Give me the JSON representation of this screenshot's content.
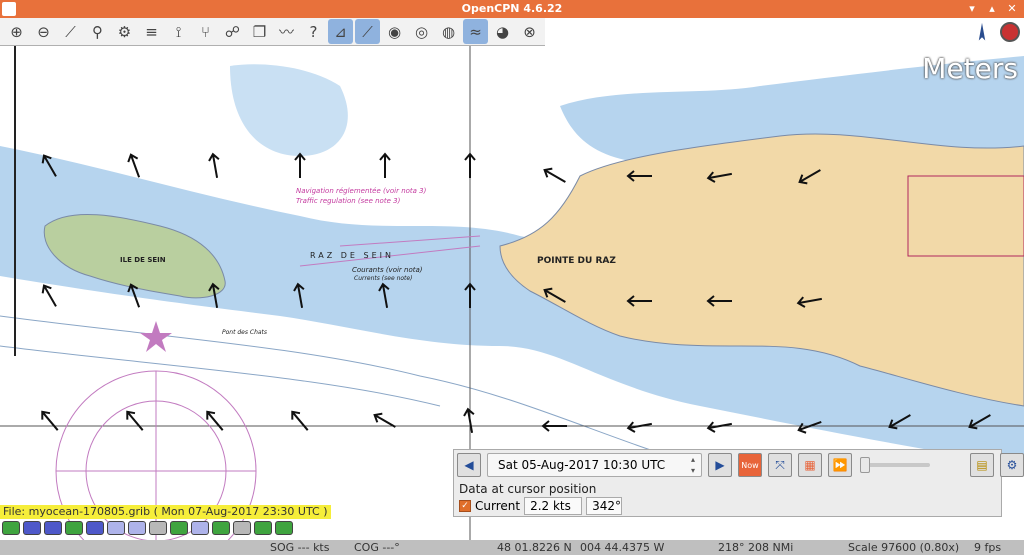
{
  "window": {
    "title": "OpenCPN 4.6.22",
    "units_label": "Meters"
  },
  "toolbar": {
    "tools": [
      {
        "name": "zoom-in-icon",
        "glyph": "⊕"
      },
      {
        "name": "zoom-out-icon",
        "glyph": "⊖"
      },
      {
        "name": "scale-icon",
        "glyph": "⟋"
      },
      {
        "name": "waypoint-icon",
        "glyph": "⚲"
      },
      {
        "name": "settings-icon",
        "glyph": "⚙"
      },
      {
        "name": "text-icon",
        "glyph": "≡"
      },
      {
        "name": "route-icon",
        "glyph": "⟟"
      },
      {
        "name": "track-icon",
        "glyph": "⑂"
      },
      {
        "name": "mob-icon",
        "glyph": "☍"
      },
      {
        "name": "copy-icon",
        "glyph": "❐"
      },
      {
        "name": "tide-icon",
        "glyph": "〰"
      },
      {
        "name": "help-icon",
        "glyph": "?"
      },
      {
        "name": "grib-icon",
        "glyph": "⊿"
      },
      {
        "name": "measure-icon",
        "glyph": "⟋"
      },
      {
        "name": "record-icon",
        "glyph": "◉"
      },
      {
        "name": "playback-icon",
        "glyph": "◎"
      },
      {
        "name": "radar-icon",
        "glyph": "◍"
      },
      {
        "name": "weather-icon",
        "glyph": "≈"
      },
      {
        "name": "globe-icon",
        "glyph": "◕"
      },
      {
        "name": "lifebuoy-icon",
        "glyph": "⊗"
      }
    ]
  },
  "grib": {
    "date": "Sat 05-Aug-2017 10:30  UTC",
    "data_title": "Data at cursor position",
    "current_label": "Current",
    "current_speed": "2.2 kts",
    "current_dir": "342°",
    "file_label": "File: myocean-170805.grib ( Mon 07-Aug-2017 23:30  UTC )",
    "now_label": "Now"
  },
  "chart_labels": {
    "pointe_du_raz": "POINTE DU RAZ",
    "ile_de_sein": "ILE DE SEIN",
    "raz_de_sein": "RAZ DE SEIN",
    "courants": "Courants (voir nota)",
    "currents": "Currents (see note)",
    "navigation": "Navigation réglementée (voir nota 3)",
    "traffic": "Traffic regulation  (see note 3)",
    "pont_des_chats": "Pont des Chats"
  },
  "status": {
    "sog": "SOG --- kts",
    "cog": "COG ---°",
    "lat": "48 01.8226 N",
    "lon": "004 44.4375 W",
    "bearing_dist": "218°  208 NMi",
    "scale": "Scale 97600 (0.80x)",
    "fps": "9 fps"
  },
  "colors": {
    "sea_shallow": "#b6d4ee",
    "sea_deep": "#ffffff",
    "land": "#f2d9a8",
    "island": "#b9cf9f",
    "active_tool": "#8fb2de",
    "file_label_bg": "#f6ee3a"
  }
}
